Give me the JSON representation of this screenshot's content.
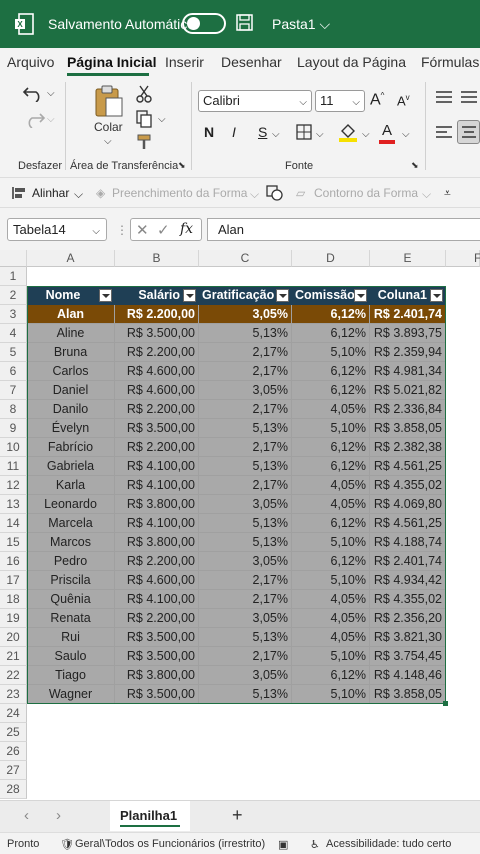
{
  "titlebar": {
    "autosave_label": "Salvamento Automático",
    "document_name": "Pasta1"
  },
  "ribbon_tabs": [
    "Arquivo",
    "Página Inicial",
    "Inserir",
    "Desenhar",
    "Layout da Página",
    "Fórmulas"
  ],
  "ribbon": {
    "undo_group": "Desfazer",
    "clipboard_group": "Área de Transferência",
    "paste_label": "Colar",
    "font_group": "Fonte",
    "font_name": "Calibri",
    "font_size": "11",
    "bold": "N",
    "italic": "I",
    "underline": "S"
  },
  "ribbon2": {
    "align_label": "Alinhar",
    "fill_label": "Preenchimento da Forma",
    "outline_label": "Contorno da Forma"
  },
  "formula_bar": {
    "name_box": "Tabela14",
    "fx": "fx",
    "value": "Alan"
  },
  "columns": [
    "A",
    "B",
    "C",
    "D",
    "E",
    "F"
  ],
  "table": {
    "headers": [
      "Nome",
      "Salário",
      "Gratificação",
      "Comissão",
      "Coluna1"
    ],
    "rows": [
      [
        "Alan",
        "R$ 2.200,00",
        "3,05%",
        "6,12%",
        "R$ 2.401,74"
      ],
      [
        "Aline",
        "R$ 3.500,00",
        "5,13%",
        "6,12%",
        "R$ 3.893,75"
      ],
      [
        "Bruna",
        "R$ 2.200,00",
        "2,17%",
        "5,10%",
        "R$ 2.359,94"
      ],
      [
        "Carlos",
        "R$ 4.600,00",
        "2,17%",
        "6,12%",
        "R$ 4.981,34"
      ],
      [
        "Daniel",
        "R$ 4.600,00",
        "3,05%",
        "6,12%",
        "R$ 5.021,82"
      ],
      [
        "Danilo",
        "R$ 2.200,00",
        "2,17%",
        "4,05%",
        "R$ 2.336,84"
      ],
      [
        "Évelyn",
        "R$ 3.500,00",
        "5,13%",
        "5,10%",
        "R$ 3.858,05"
      ],
      [
        "Fabrício",
        "R$ 2.200,00",
        "2,17%",
        "6,12%",
        "R$ 2.382,38"
      ],
      [
        "Gabriela",
        "R$ 4.100,00",
        "5,13%",
        "6,12%",
        "R$ 4.561,25"
      ],
      [
        "Karla",
        "R$ 4.100,00",
        "2,17%",
        "4,05%",
        "R$ 4.355,02"
      ],
      [
        "Leonardo",
        "R$ 3.800,00",
        "3,05%",
        "4,05%",
        "R$ 4.069,80"
      ],
      [
        "Marcela",
        "R$ 4.100,00",
        "5,13%",
        "6,12%",
        "R$ 4.561,25"
      ],
      [
        "Marcos",
        "R$ 3.800,00",
        "5,13%",
        "5,10%",
        "R$ 4.188,74"
      ],
      [
        "Pedro",
        "R$ 2.200,00",
        "3,05%",
        "6,12%",
        "R$ 2.401,74"
      ],
      [
        "Priscila",
        "R$ 4.600,00",
        "2,17%",
        "5,10%",
        "R$ 4.934,42"
      ],
      [
        "Quênia",
        "R$ 4.100,00",
        "2,17%",
        "4,05%",
        "R$ 4.355,02"
      ],
      [
        "Renata",
        "R$ 2.200,00",
        "3,05%",
        "4,05%",
        "R$ 2.356,20"
      ],
      [
        "Rui",
        "R$ 3.500,00",
        "5,13%",
        "4,05%",
        "R$ 3.821,30"
      ],
      [
        "Saulo",
        "R$ 3.500,00",
        "2,17%",
        "5,10%",
        "R$ 3.754,45"
      ],
      [
        "Tiago",
        "R$ 3.800,00",
        "3,05%",
        "6,12%",
        "R$ 4.148,46"
      ],
      [
        "Wagner",
        "R$ 3.500,00",
        "5,13%",
        "5,10%",
        "R$ 3.858,05"
      ]
    ]
  },
  "row_numbers": [
    "1",
    "2",
    "3",
    "4",
    "5",
    "6",
    "7",
    "8",
    "9",
    "10",
    "11",
    "12",
    "13",
    "14",
    "15",
    "16",
    "17",
    "18",
    "19",
    "20",
    "21",
    "22",
    "23",
    "24",
    "25",
    "26",
    "27",
    "28"
  ],
  "sheet_tab": "Planilha1",
  "status": {
    "ready": "Pronto",
    "sensitivity": "Geral\\Todos os Funcionários (irrestrito)",
    "accessibility": "Acessibilidade: tudo certo"
  },
  "colors": {
    "excel_green": "#1d6f42",
    "header_fill": "#1f3f55",
    "selected_row": "#7a4a06",
    "body_fill": "#a9a9a9"
  }
}
